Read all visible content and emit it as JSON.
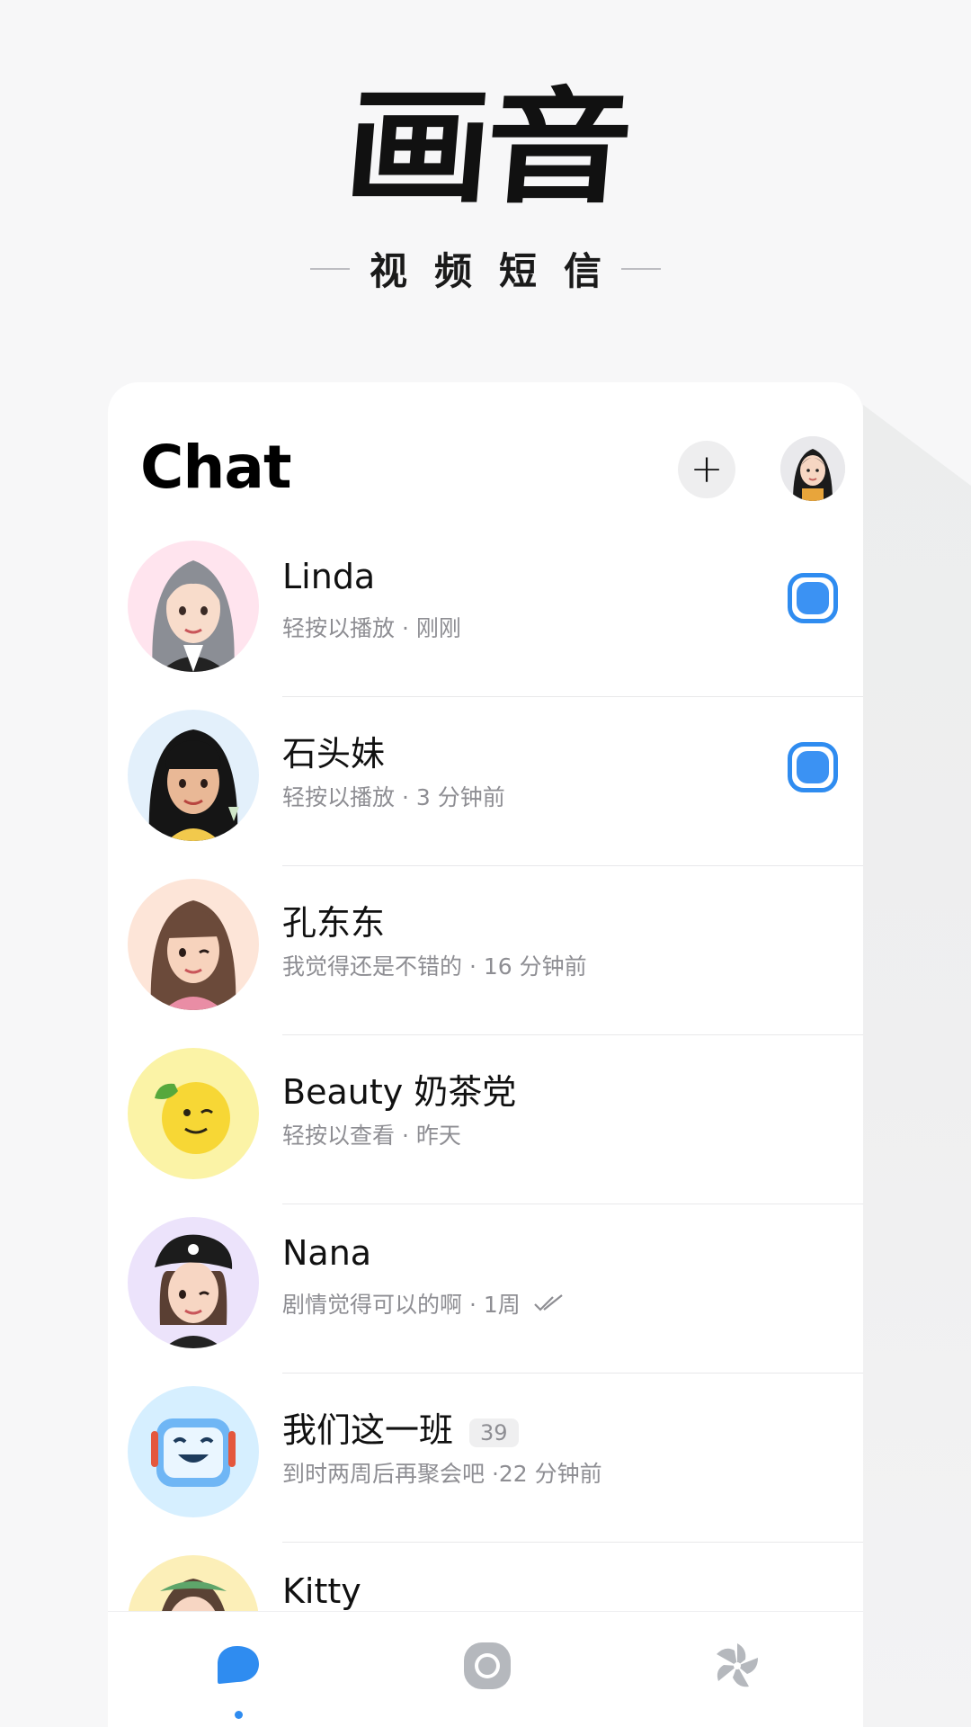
{
  "brand": {
    "logo_text": "画音",
    "tagline": "视频短信"
  },
  "header": {
    "title": "Chat",
    "add_button_label": "+",
    "add_icon": "plus-icon",
    "profile_icon": "avatar"
  },
  "chats": [
    {
      "name": "Linda",
      "subtitle": "轻按以播放 · 刚刚",
      "unread": true,
      "avatar_bg": "#ffe4ee"
    },
    {
      "name": "石头妹",
      "subtitle": "轻按以播放 · 3 分钟前",
      "unread": true,
      "avatar_bg": "#e3f0fb"
    },
    {
      "name": "孔东东",
      "subtitle": "我觉得还是不错的 · 16 分钟前",
      "unread": false,
      "avatar_bg": "#fde5d8"
    },
    {
      "name": "Beauty 奶茶党",
      "subtitle": "轻按以查看 · 昨天",
      "unread": false,
      "avatar_bg": "#fbf3a6"
    },
    {
      "name": "Nana",
      "subtitle": "剧情觉得可以的啊 · 1周",
      "unread": false,
      "avatar_bg": "#ece3fb",
      "read_receipt": true
    },
    {
      "name": "我们这一班",
      "member_count": "39",
      "subtitle": "到时两周后再聚会吧 ·22 分钟前",
      "unread": false,
      "avatar_bg": "#d6efff"
    },
    {
      "name": "Kitty",
      "subtitle": "",
      "unread": false,
      "avatar_bg": "#fcefb8"
    }
  ],
  "tabbar": {
    "tabs": [
      {
        "icon": "chat-bubble-icon",
        "active": true
      },
      {
        "icon": "camera-icon",
        "active": false
      },
      {
        "icon": "pinwheel-icon",
        "active": false
      }
    ]
  },
  "colors": {
    "accent": "#2f8cf0",
    "background": "#f7f7f8",
    "secondary_text": "#8e8e93",
    "inactive_icon": "#b5b8bd"
  }
}
